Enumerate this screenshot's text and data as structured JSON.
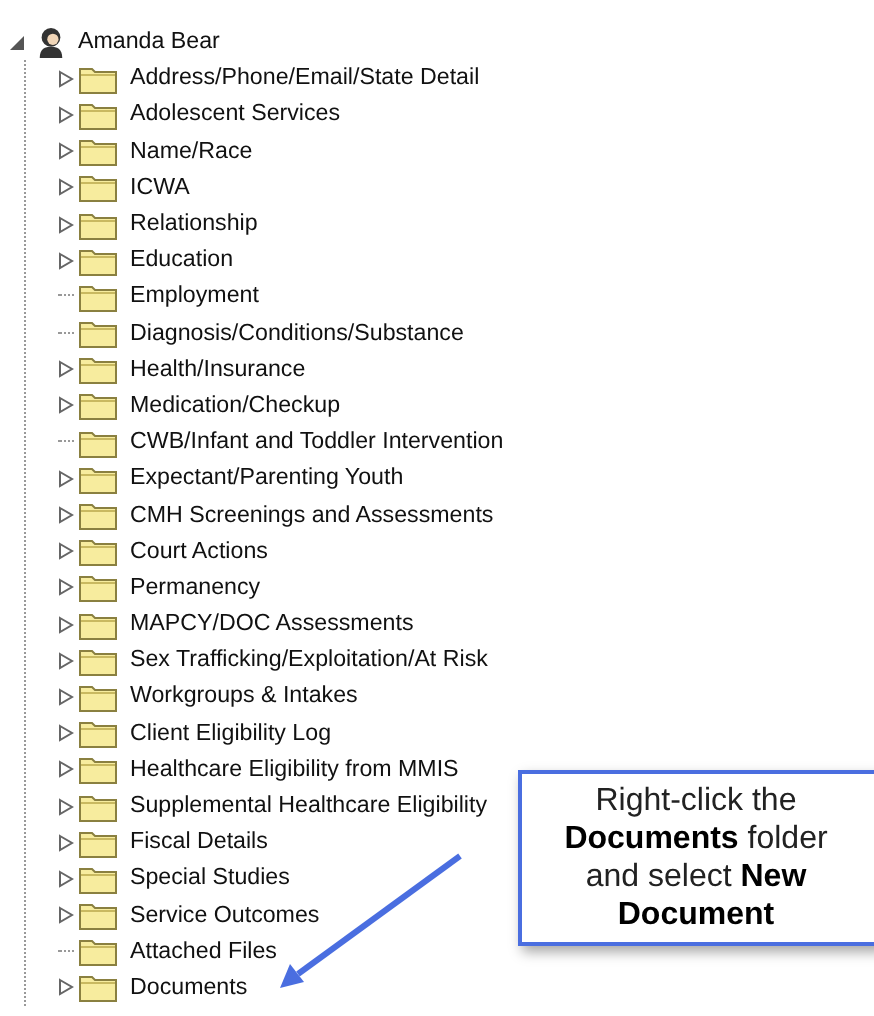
{
  "tree": {
    "root": {
      "label": "Amanda Bear",
      "expanded": true,
      "children": [
        {
          "label": "Address/Phone/Email/State Detail",
          "kind": "branch"
        },
        {
          "label": "Adolescent Services",
          "kind": "branch"
        },
        {
          "label": "Name/Race",
          "kind": "branch"
        },
        {
          "label": "ICWA",
          "kind": "branch"
        },
        {
          "label": "Relationship",
          "kind": "branch"
        },
        {
          "label": "Education",
          "kind": "branch"
        },
        {
          "label": "Employment",
          "kind": "leaf"
        },
        {
          "label": "Diagnosis/Conditions/Substance",
          "kind": "leaf"
        },
        {
          "label": "Health/Insurance",
          "kind": "branch"
        },
        {
          "label": "Medication/Checkup",
          "kind": "branch"
        },
        {
          "label": "CWB/Infant and Toddler Intervention",
          "kind": "leaf"
        },
        {
          "label": "Expectant/Parenting Youth",
          "kind": "branch"
        },
        {
          "label": "CMH Screenings and Assessments",
          "kind": "branch"
        },
        {
          "label": "Court Actions",
          "kind": "branch"
        },
        {
          "label": "Permanency",
          "kind": "branch"
        },
        {
          "label": "MAPCY/DOC Assessments",
          "kind": "branch"
        },
        {
          "label": "Sex Trafficking/Exploitation/At Risk",
          "kind": "branch"
        },
        {
          "label": "Workgroups & Intakes",
          "kind": "branch"
        },
        {
          "label": "Client Eligibility Log",
          "kind": "branch"
        },
        {
          "label": "Healthcare Eligibility from MMIS",
          "kind": "branch"
        },
        {
          "label": "Supplemental Healthcare Eligibility",
          "kind": "branch"
        },
        {
          "label": "Fiscal Details",
          "kind": "branch"
        },
        {
          "label": "Special Studies",
          "kind": "branch"
        },
        {
          "label": "Service Outcomes",
          "kind": "branch"
        },
        {
          "label": "Attached Files",
          "kind": "leaf"
        },
        {
          "label": "Documents",
          "kind": "branch"
        }
      ]
    }
  },
  "callout": {
    "text": "Right-click the **Documents** folder and select **New Document**"
  }
}
